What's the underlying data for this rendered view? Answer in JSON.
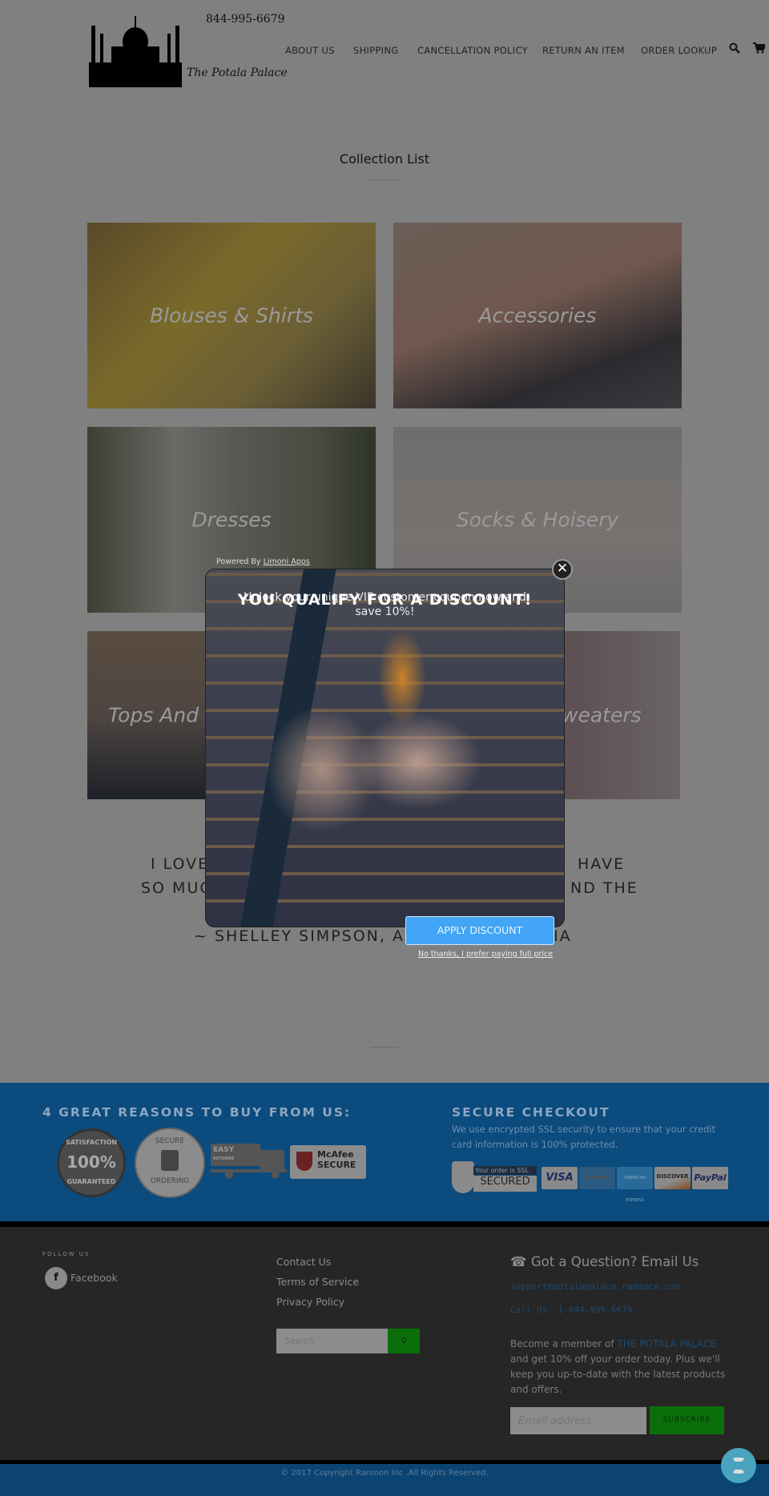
{
  "header": {
    "phone": "844-995-6679",
    "logo_text": "The Potala Palace",
    "nav": [
      "ABOUT US",
      "SHIPPING",
      "CANCELLATION POLICY",
      "RETURN AN ITEM",
      "ORDER LOOKUP"
    ],
    "icons": [
      "search-icon",
      "cart-icon"
    ]
  },
  "collection": {
    "title": "Collection List",
    "tiles": [
      "Blouses & Shirts",
      "Accessories",
      "Dresses",
      "Socks & Hoisery",
      "Tops And",
      "weaters"
    ]
  },
  "quote": {
    "line1a": "I LOVE",
    "line1b": "HAVE",
    "line2a": "SO MUC",
    "line2b": "ND THE",
    "line3a": "~ SHELLEY SIMPSON, AN",
    "line3b": "IA"
  },
  "popup": {
    "powered_by": "Powered By",
    "powered_link": "Limoni Apps",
    "headline": "YOU QUALIFY FOR A DISCOUNT!",
    "subtext": "Unlock your unique VIP customer coupon now and save 10%!",
    "apply_label": "APPLY DISCOUNT",
    "decline_label": "No thanks, I prefer paying full price",
    "close_icon": "close-icon",
    "accent": "#42a5f5"
  },
  "reasons": {
    "title": "4 GREAT REASONS TO BUY FROM US:",
    "badges": {
      "satisfaction_top": "SATISFACTION",
      "satisfaction_mid": "100%",
      "satisfaction_bot": "GUARANTEED",
      "secure_top": "SECURE",
      "secure_bot": "ORDERING",
      "easy": "EASY",
      "returns": "RETURNS",
      "mcafee1": "McAfee",
      "mcafee2": "SECURE"
    }
  },
  "checkout": {
    "title": "SECURE CHECKOUT",
    "text1": "We use encrypted SSL security to ensure that your credit",
    "text2": "card information is 100% protected.",
    "ssl1": "Your order is SSL",
    "ssl2": "SECURED",
    "cards": [
      "VISA",
      "mastercard",
      "AMERICAN EXPRESS",
      "DISCOVER",
      "PayPal"
    ]
  },
  "footer": {
    "follow": "FOLLOW US",
    "facebook": "Facebook",
    "links": [
      "Contact Us",
      "Terms of Service",
      "Privacy Policy"
    ],
    "search_placeholder": "Search",
    "question": "Got a Question? Email Us",
    "email": "support@potalapalace.radmace.com",
    "call": "Call Us: 1-844-995-6679",
    "member_pre": "Become a member of",
    "member_brand": "THE POTALA PALACE",
    "member_l2": "and get 10% off your order today. Plus we'll",
    "member_l3": "keep you up-to-date with the latest products",
    "member_l4": "and offers.",
    "email_placeholder": "Email address",
    "subscribe": "SUBSCRIBE",
    "copyright": "© 2017 Copyright Ranmon Inc .All Rights Reserved."
  }
}
